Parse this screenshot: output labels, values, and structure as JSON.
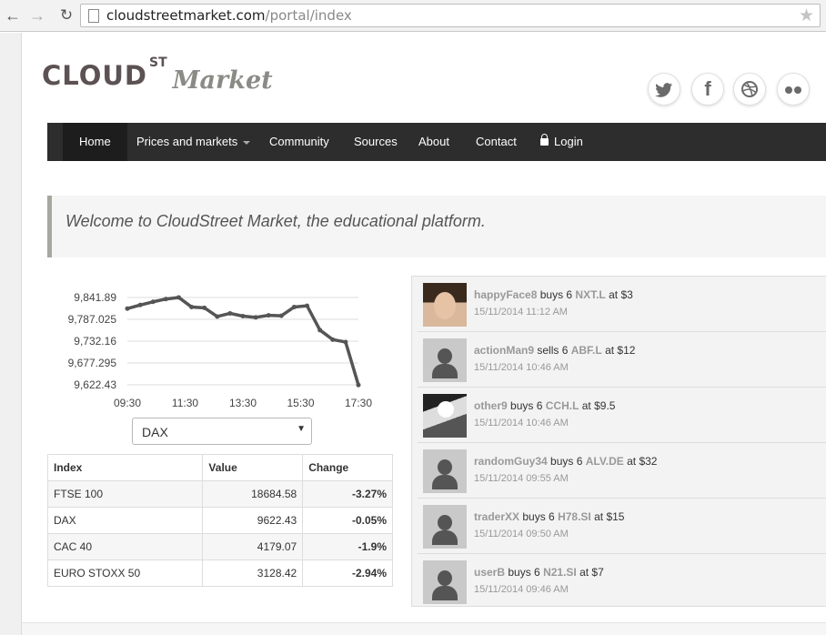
{
  "browser": {
    "url_host": "cloudstreetmarket.com",
    "url_path": "/portal/index"
  },
  "logo": {
    "main": "CLOUD",
    "sup": "ST",
    "sub": "Market"
  },
  "social": [
    "twitter-icon",
    "facebook-icon",
    "dribbble-icon",
    "flickr-icon"
  ],
  "nav": {
    "home": "Home",
    "prices": "Prices and markets",
    "community": "Community",
    "sources": "Sources",
    "about": "About",
    "contact": "Contact",
    "login": "Login"
  },
  "welcome": "Welcome to CloudStreet Market, the educational platform.",
  "chart_data": {
    "type": "line",
    "x": [
      "09:30",
      "11:30",
      "13:30",
      "15:30",
      "17:30"
    ],
    "yticks": [
      "9,841.89",
      "9,787.025",
      "9,732.16",
      "9,677.295",
      "9,622.43"
    ],
    "ylim": [
      9622.43,
      9841.89
    ],
    "values": [
      9814,
      9823,
      9831,
      9838,
      9842,
      9818,
      9816,
      9794,
      9802,
      9795,
      9792,
      9797,
      9796,
      9818,
      9821,
      9760,
      9736,
      9730,
      9622
    ],
    "color": "#555555"
  },
  "select": {
    "value": "DAX"
  },
  "table": {
    "headers": [
      "Index",
      "Value",
      "Change"
    ],
    "rows": [
      [
        "FTSE 100",
        "18684.58",
        "-3.27%"
      ],
      [
        "DAX",
        "9622.43",
        "-0.05%"
      ],
      [
        "CAC 40",
        "4179.07",
        "-1.9%"
      ],
      [
        "EURO STOXX 50",
        "3128.42",
        "-2.94%"
      ]
    ]
  },
  "feed": [
    {
      "user": "happyFace8",
      "action": "buys 6",
      "ticker": "NXT.L",
      "price": "at $3",
      "time": "15/11/2014 11:12 AM",
      "avatar": "photo1"
    },
    {
      "user": "actionMan9",
      "action": "sells 6",
      "ticker": "ABF.L",
      "price": "at $12",
      "time": "15/11/2014 10:46 AM",
      "avatar": "person"
    },
    {
      "user": "other9",
      "action": "buys 6",
      "ticker": "CCH.L",
      "price": "at $9.5",
      "time": "15/11/2014 10:46 AM",
      "avatar": "photo2"
    },
    {
      "user": "randomGuy34",
      "action": "buys 6",
      "ticker": "ALV.DE",
      "price": "at $32",
      "time": "15/11/2014 09:55 AM",
      "avatar": "person"
    },
    {
      "user": "traderXX",
      "action": "buys 6",
      "ticker": "H78.SI",
      "price": "at $15",
      "time": "15/11/2014 09:50 AM",
      "avatar": "person"
    },
    {
      "user": "userB",
      "action": "buys 6",
      "ticker": "N21.SI",
      "price": "at $7",
      "time": "15/11/2014 09:46 AM",
      "avatar": "person"
    }
  ]
}
